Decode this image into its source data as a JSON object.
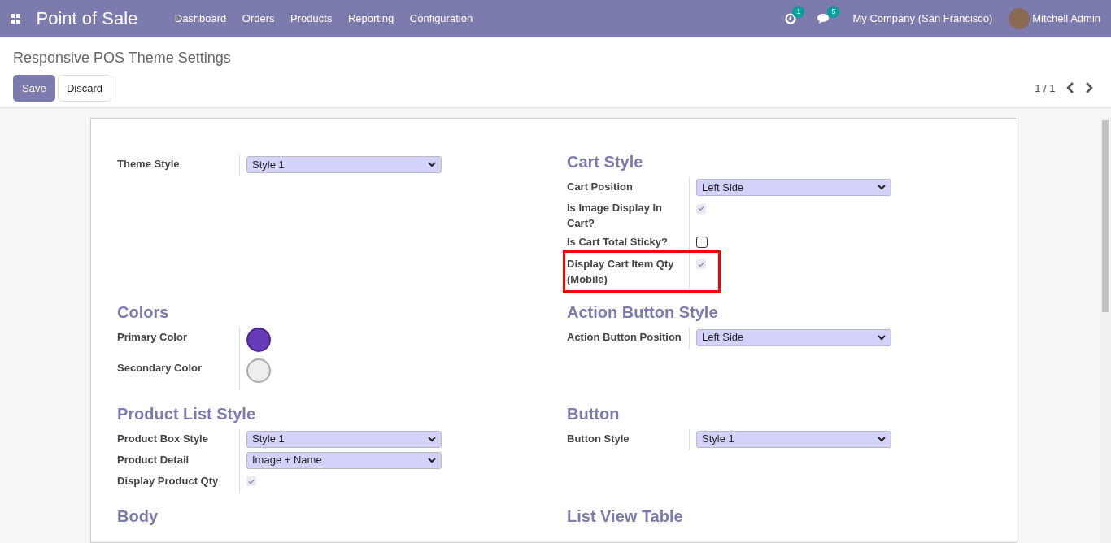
{
  "navbar": {
    "app_title": "Point of Sale",
    "menu": [
      "Dashboard",
      "Orders",
      "Products",
      "Reporting",
      "Configuration"
    ],
    "activity_count": "1",
    "message_count": "5",
    "company": "My Company (San Francisco)",
    "user": "Mitchell Admin"
  },
  "control_panel": {
    "breadcrumb": "Responsive POS Theme Settings",
    "buttons": [
      {
        "label": "Save",
        "kind": "primary"
      },
      {
        "label": "Discard",
        "kind": "secondary"
      }
    ],
    "pager": "1 / 1"
  },
  "sections": [
    {
      "fields": [
        {
          "label": "Theme Style",
          "kind": "select",
          "value": "Style 1"
        }
      ]
    },
    {
      "title": "Cart Style",
      "fields": [
        {
          "label": "Cart Position",
          "kind": "select",
          "value": "Left Side"
        },
        {
          "label": "Is Image Display In Cart?",
          "kind": "checkbox",
          "checked": true,
          "highlighted": false
        },
        {
          "label": "Is Cart Total Sticky?",
          "kind": "checkbox",
          "checked": false,
          "highlighted": false
        },
        {
          "label": "Display Cart Item Qty (Mobile)",
          "kind": "checkbox",
          "checked": true,
          "highlighted": true
        }
      ]
    },
    {
      "title": "Colors",
      "fields": [
        {
          "label": "Primary Color",
          "kind": "color",
          "color": "#673ab7"
        },
        {
          "label": "Secondary Color",
          "kind": "color",
          "color": "#eeeeee"
        }
      ]
    },
    {
      "title": "Action Button Style",
      "fields": [
        {
          "label": "Action Button Position",
          "kind": "select",
          "value": "Left Side"
        }
      ]
    },
    {
      "title": "Product List Style",
      "fields": [
        {
          "label": "Product Box Style",
          "kind": "select",
          "value": "Style 1"
        },
        {
          "label": "Product Detail",
          "kind": "select",
          "value": "Image + Name"
        },
        {
          "label": "Display Product Qty",
          "kind": "checkbox",
          "checked": true
        }
      ]
    },
    {
      "title": "Button",
      "fields": [
        {
          "label": "Button Style",
          "kind": "select",
          "value": "Style 1"
        }
      ]
    },
    {
      "title": "Body"
    },
    {
      "title": "List View Table"
    }
  ]
}
